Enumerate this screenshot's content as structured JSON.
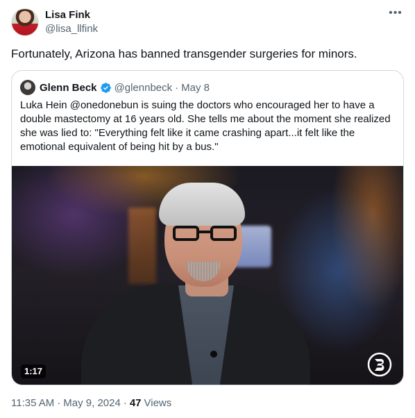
{
  "author": {
    "display_name": "Lisa Fink",
    "handle": "@lisa_llfink"
  },
  "tweet": {
    "text": "Fortunately, Arizona has banned transgender surgeries for minors."
  },
  "quoted": {
    "display_name": "Glenn Beck",
    "handle": "@glennbeck",
    "separator": "·",
    "date": "May 8",
    "text": "Luka Hein @onedonebun is suing the doctors who encouraged her to have a double mastectomy at 16 years old. She tells me about the moment she realized she was lied to: \"Everything felt like it came crashing apart...it felt like the emotional equivalent of being hit by a bus.\"",
    "video_duration": "1:17",
    "verified_color": "#1d9bf0"
  },
  "meta": {
    "time": "11:35 AM",
    "separator": "·",
    "date": "May 9, 2024",
    "views_count": "47",
    "views_label": "Views"
  },
  "icons": {
    "more": "more-horizontal-icon",
    "verified": "verified-badge-icon",
    "logo": "blaze-logo-icon"
  }
}
